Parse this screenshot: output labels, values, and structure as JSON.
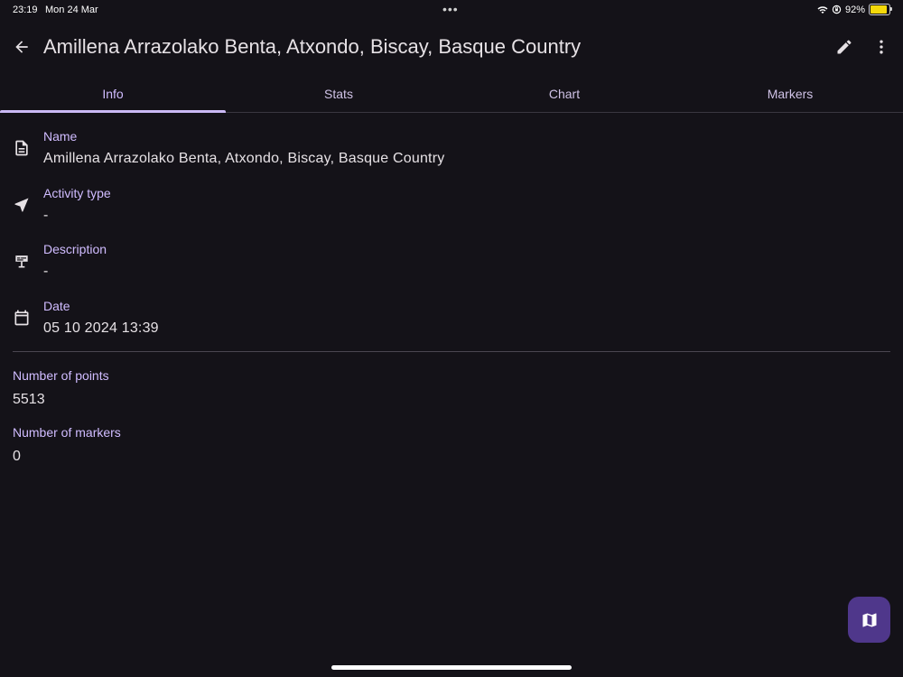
{
  "status_bar": {
    "time": "23:19",
    "date": "Mon 24 Mar",
    "battery": "92%",
    "battery_level": 0.92
  },
  "app_bar": {
    "title": "Amillena Arrazolako Benta, Atxondo, Biscay, Basque Country",
    "icons": {
      "back": "arrow-back-icon",
      "edit": "pencil-icon",
      "more": "more-vert-icon"
    }
  },
  "tabs": [
    {
      "label": "Info",
      "active": true
    },
    {
      "label": "Stats",
      "active": false
    },
    {
      "label": "Chart",
      "active": false
    },
    {
      "label": "Markers",
      "active": false
    }
  ],
  "info": {
    "name": {
      "label": "Name",
      "value": "Amillena Arrazolako Benta, Atxondo, Biscay, Basque Country",
      "icon": "document-icon"
    },
    "activity_type": {
      "label": "Activity type",
      "value": "-",
      "icon": "navigation-arrow-icon"
    },
    "description": {
      "label": "Description",
      "value": "-",
      "icon": "signpost-icon"
    },
    "date": {
      "label": "Date",
      "value": "05 10 2024 13:39",
      "icon": "calendar-icon"
    }
  },
  "stats": {
    "points": {
      "label": "Number of points",
      "value": "5513"
    },
    "markers": {
      "label": "Number of markers",
      "value": "0"
    }
  },
  "fab": {
    "icon": "map-icon"
  },
  "colors": {
    "background": "#141218",
    "accent": "#d0bcff",
    "fab": "#4f378b",
    "text": "#e6e1e5"
  }
}
